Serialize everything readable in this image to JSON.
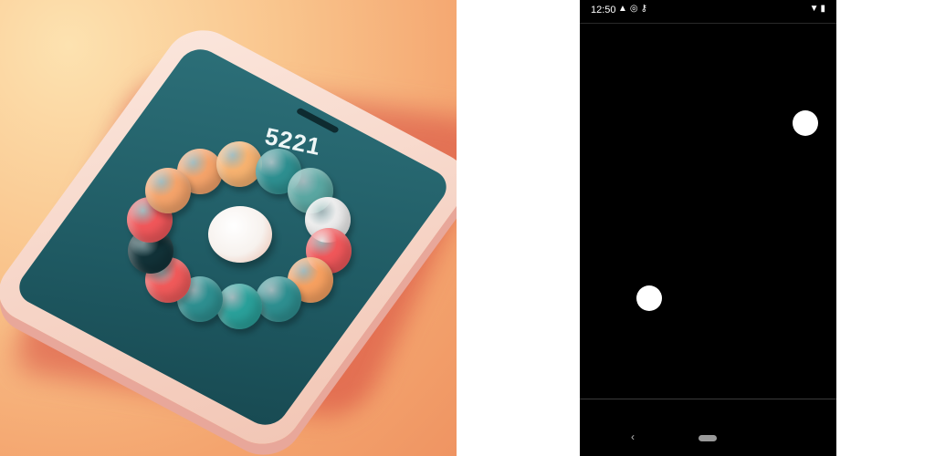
{
  "promo": {
    "score": "5221",
    "bead_colors": [
      "#f4a36a",
      "#f6b270",
      "#2e8f90",
      "#5aa7a2",
      "#ececec",
      "#f0575a",
      "#f6a060",
      "#2e8f90",
      "#2aa09a",
      "#2e8f90",
      "#f05a5a",
      "#123238",
      "#f0575a",
      "#f4a36a"
    ]
  },
  "status_bar": {
    "time": "12:50",
    "left_icons": [
      "warning-icon",
      "sync-icon",
      "key-icon"
    ],
    "right_icons": [
      "wifi-icon",
      "battery-icon"
    ]
  },
  "game": {
    "background": "#000000",
    "ball_color": "#ffffff",
    "ball_count": 2
  },
  "nav": {
    "back_symbol": "‹"
  }
}
